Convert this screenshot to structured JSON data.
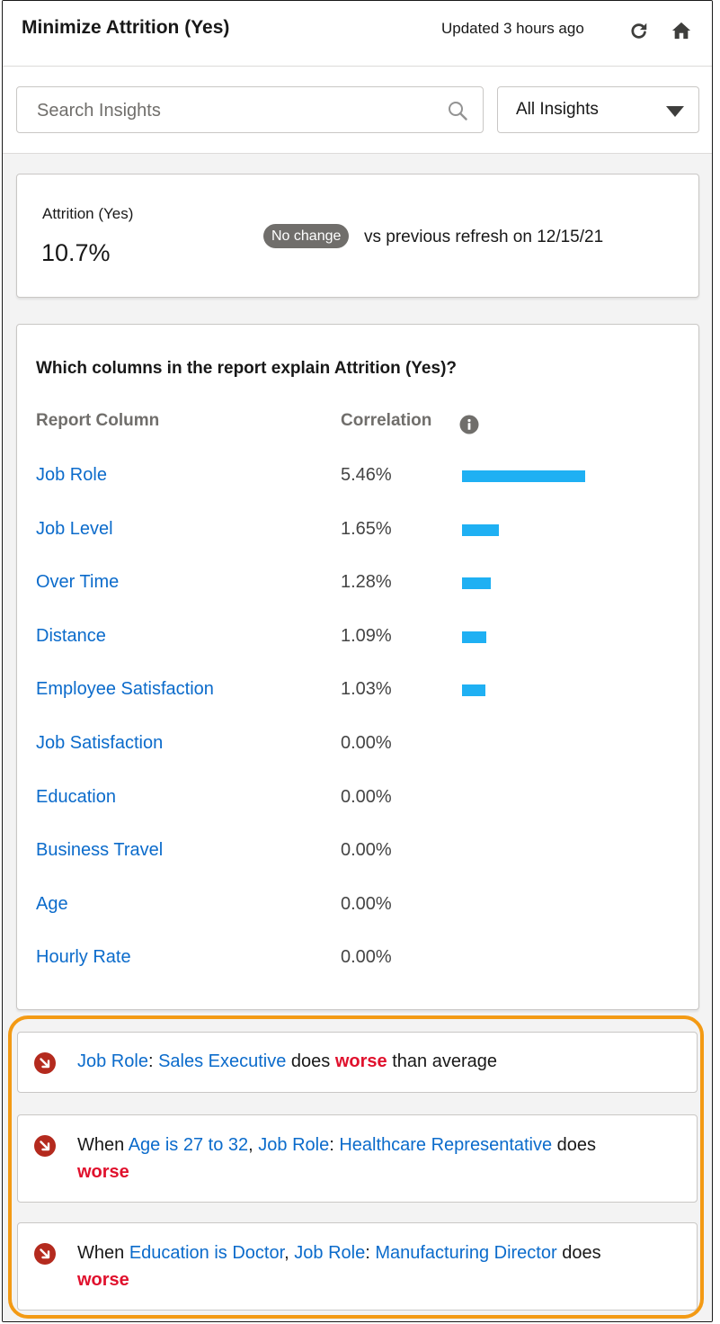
{
  "header": {
    "title": "Minimize Attrition (Yes)",
    "updated": "Updated 3 hours ago"
  },
  "search": {
    "placeholder": "Search Insights",
    "value": "",
    "filter_label": "All Insights"
  },
  "metric": {
    "label": "Attrition (Yes)",
    "value": "10.7%",
    "badge": "No change",
    "comparison": "vs previous refresh on 12/15/21"
  },
  "correlation": {
    "heading": "Which columns in the report explain Attrition (Yes)?",
    "col_report": "Report Column",
    "col_corr": "Correlation",
    "bar_color": "#1fb0f3",
    "rows": [
      {
        "name": "Job Role",
        "value": "5.46%",
        "pct": 5.46
      },
      {
        "name": "Job Level",
        "value": "1.65%",
        "pct": 1.65
      },
      {
        "name": "Over Time",
        "value": "1.28%",
        "pct": 1.28
      },
      {
        "name": "Distance",
        "value": "1.09%",
        "pct": 1.09
      },
      {
        "name": "Employee Satisfaction",
        "value": "1.03%",
        "pct": 1.03
      },
      {
        "name": "Job Satisfaction",
        "value": "0.00%",
        "pct": 0
      },
      {
        "name": "Education",
        "value": "0.00%",
        "pct": 0
      },
      {
        "name": "Business Travel",
        "value": "0.00%",
        "pct": 0
      },
      {
        "name": "Age",
        "value": "0.00%",
        "pct": 0
      },
      {
        "name": "Hourly Rate",
        "value": "0.00%",
        "pct": 0
      }
    ]
  },
  "insights": [
    {
      "link1": "Job Role",
      "sep1": ": ",
      "link2": "Sales Executive",
      "mid": " does ",
      "worse": "worse",
      "tail": " than average"
    },
    {
      "prefix": "When ",
      "link1": "Age is 27 to 32",
      "sep1": ", ",
      "link2": "Job Role",
      "sep2": ": ",
      "link3": "Healthcare Representative",
      "mid": " does",
      "worse": "worse"
    },
    {
      "prefix": "When ",
      "link1": "Education is Doctor",
      "sep1": ", ",
      "link2": "Job Role",
      "sep2": ": ",
      "link3": "Manufacturing Director",
      "mid": " does",
      "worse": "worse"
    }
  ],
  "colors": {
    "link": "#0b6bcb",
    "worse": "#e0112d",
    "highlight": "#f39a14",
    "alert_icon": "#b42a1e"
  },
  "icons": {
    "refresh": "refresh-icon",
    "home": "home-icon",
    "search": "search-icon",
    "info": "info-icon",
    "trend": "arrow-down-right-icon"
  }
}
